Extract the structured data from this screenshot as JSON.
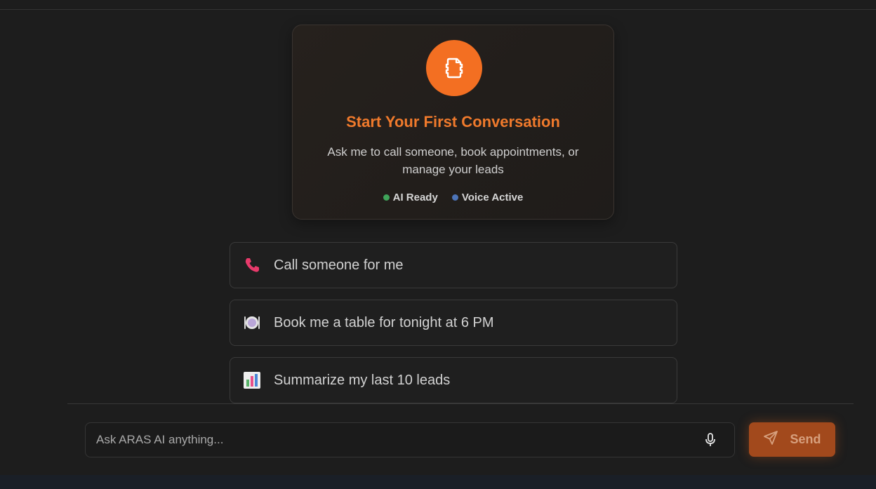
{
  "hero": {
    "icon": "document-icon",
    "title": "Start Your First Conversation",
    "subtitle_line1": "Ask me to call someone, book appointments, or",
    "subtitle_line2": "manage your leads",
    "status": [
      {
        "label": "AI Ready",
        "color": "#3fa45a"
      },
      {
        "label": "Voice Active",
        "color": "#4c74b8"
      }
    ]
  },
  "suggestions": [
    {
      "icon": "phone-icon",
      "label": "Call someone for me"
    },
    {
      "icon": "plate-cutlery-icon",
      "label": "Book me a table for tonight at 6 PM"
    },
    {
      "icon": "bar-chart-icon",
      "label": "Summarize my last 10 leads"
    }
  ],
  "composer": {
    "placeholder": "Ask ARAS AI anything...",
    "value": "",
    "mic_icon": "microphone-icon",
    "send_icon": "send-icon",
    "send_label": "Send"
  },
  "colors": {
    "accent": "#f36f22",
    "title": "#f07a2c",
    "send_bg": "#a2491c",
    "background": "#1d1d1d"
  }
}
